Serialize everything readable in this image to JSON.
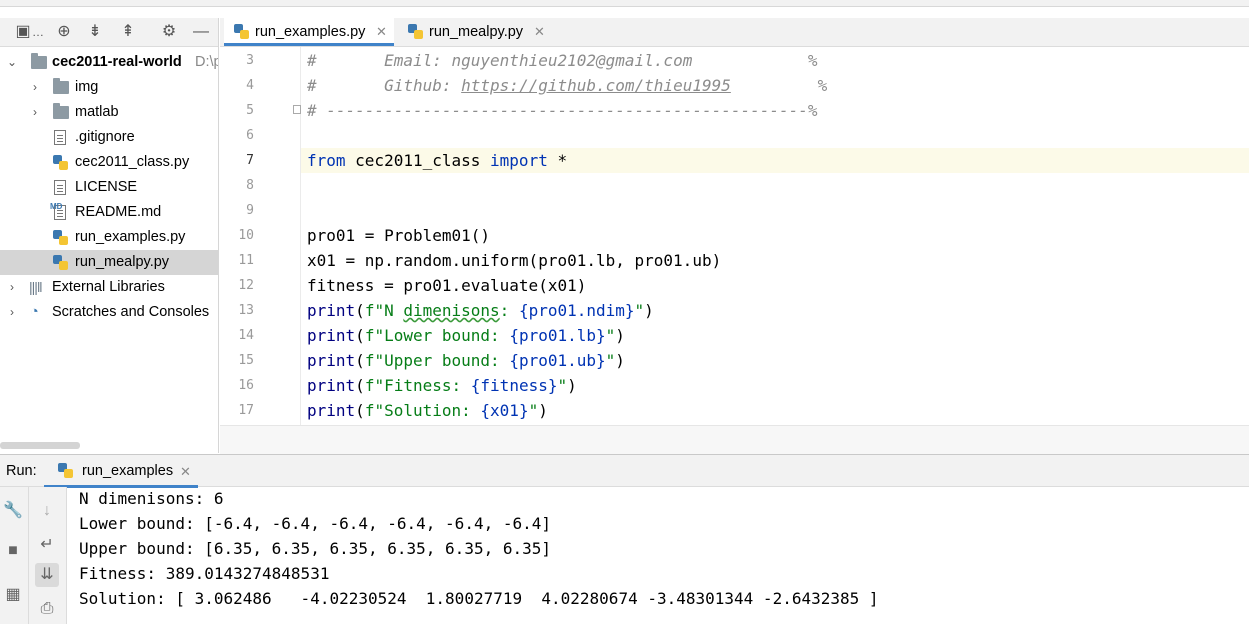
{
  "project": {
    "root_name": "cec2011-real-world",
    "root_path": "D:\\p",
    "items": [
      {
        "label": "img"
      },
      {
        "label": "matlab"
      },
      {
        "label": ".gitignore"
      },
      {
        "label": "cec2011_class.py"
      },
      {
        "label": "LICENSE"
      },
      {
        "label": "README.md"
      },
      {
        "label": "run_examples.py"
      },
      {
        "label": "run_mealpy.py"
      }
    ],
    "external_libraries": "External Libraries",
    "scratches": "Scratches and Consoles",
    "md_badge": "MD"
  },
  "tabs": [
    {
      "label": "run_examples.py",
      "close": "✕"
    },
    {
      "label": "run_mealpy.py",
      "close": "✕"
    }
  ],
  "editor": {
    "line_numbers": [
      "3",
      "4",
      "5",
      "6",
      "7",
      "8",
      "9",
      "10",
      "11",
      "12",
      "13",
      "14",
      "15",
      "16",
      "17"
    ],
    "line3": {
      "hash": "#",
      "text": "Email: nguyenthieu2102@gmail.com",
      "end": "%"
    },
    "line4": {
      "hash": "#",
      "label": "Github: ",
      "url": "https://github.com/thieu1995",
      "end": "%"
    },
    "line5": "# --------------------------------------------------%",
    "line7": {
      "from": "from",
      "module": " cec2011_class ",
      "import": "import",
      "star": " *"
    },
    "line10": "pro01 = Problem01()",
    "line11": "x01 = np.random.uniform(pro01.lb, pro01.ub)",
    "line12": "fitness = pro01.evaluate(x01)",
    "line13": {
      "print": "print",
      "open": "(",
      "f": "f\"N ",
      "sq": "dimenisons",
      "s": ": ",
      "expr": "{pro01.ndim}",
      "endq": "\"",
      "close": ")"
    },
    "line14": {
      "print": "print",
      "open": "(",
      "f": "f\"Lower bound: ",
      "expr": "{pro01.lb}",
      "endq": "\"",
      "close": ")"
    },
    "line15": {
      "print": "print",
      "open": "(",
      "f": "f\"Upper bound: ",
      "expr": "{pro01.ub}",
      "endq": "\"",
      "close": ")"
    },
    "line16": {
      "print": "print",
      "open": "(",
      "f": "f\"Fitness: ",
      "expr": "{fitness}",
      "endq": "\"",
      "close": ")"
    },
    "line17": {
      "print": "print",
      "open": "(",
      "f": "f\"Solution: ",
      "expr": "{x01}",
      "endq": "\"",
      "close": ")"
    }
  },
  "run": {
    "label": "Run:",
    "tab": "run_examples",
    "tab_close": "✕",
    "output": [
      "N dimenisons: 6",
      "Lower bound: [-6.4, -6.4, -6.4, -6.4, -6.4, -6.4]",
      "Upper bound: [6.35, 6.35, 6.35, 6.35, 6.35, 6.35]",
      "Fitness: 389.0143274848531",
      "Solution: [ 3.062486   -4.02230524  1.80027719  4.02280674 -3.48301344 -2.6432385 ]"
    ]
  },
  "icons": {
    "toolbar": [
      "project-view-icon",
      "locate-icon",
      "expand-all-icon",
      "collapse-all-icon",
      "gear-icon",
      "minimize-icon"
    ],
    "colors": {
      "accent": "#4083c9",
      "keyword": "#0033b3",
      "string": "#067d17",
      "comment": "#8c8c8c"
    }
  }
}
